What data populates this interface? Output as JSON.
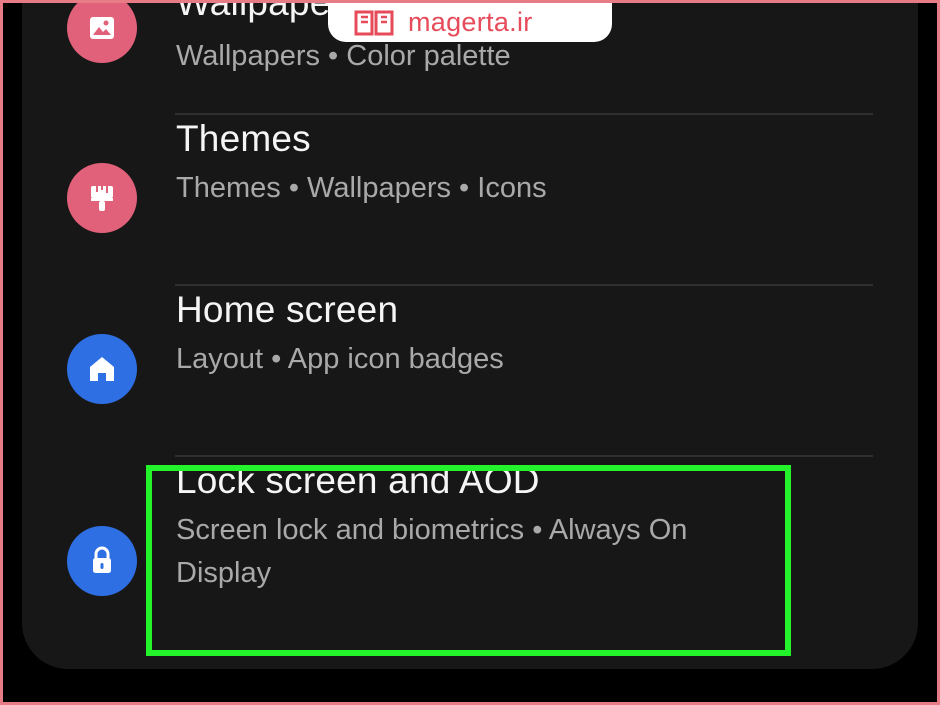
{
  "watermark": {
    "text": "magerta.ir"
  },
  "settings": {
    "items": [
      {
        "title": "Wallpaper",
        "subtitle": "Wallpapers • Color palette",
        "icon": "image-icon",
        "color": "#e2617a"
      },
      {
        "title": "Themes",
        "subtitle": "Themes • Wallpapers • Icons",
        "icon": "paint-brush-icon",
        "color": "#e2617a"
      },
      {
        "title": "Home screen",
        "subtitle": "Layout • App icon badges",
        "icon": "home-icon",
        "color": "#2f6fe4"
      },
      {
        "title": "Lock screen and AOD",
        "subtitle": "Screen lock and biometrics • Always On Display",
        "icon": "lock-icon",
        "color": "#2f6fe4"
      }
    ]
  },
  "colors": {
    "highlight": "#22f32a",
    "frame": "#e77c86",
    "background": "#171717"
  }
}
